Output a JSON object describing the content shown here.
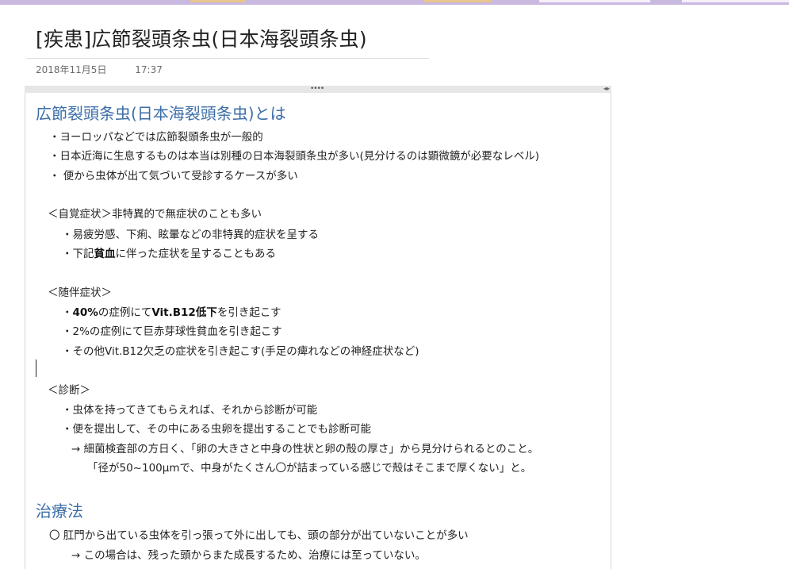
{
  "page": {
    "title": "[疾患]広節裂頭条虫(日本海裂頭条虫)",
    "date": "2018年11月5日",
    "time": "17:37"
  },
  "container": {
    "grip": "••••",
    "resize": "◂▸"
  },
  "note": {
    "heading1": "広節裂頭条虫(日本海裂頭条虫)とは",
    "intro": [
      "・ヨーロッパなどでは広節裂頭条虫が一般的",
      "・日本近海に生息するものは本当は別種の日本海裂頭条虫が多い(見分けるのは顕微鏡が必要なレベル)",
      "・ 便から虫体が出て気づいて受診するケースが多い"
    ],
    "symptoms_header": "＜自覚症状＞非特異的で無症状のことも多い",
    "symptoms": [
      "・易疲労感、下痢、眩暈などの非特異的症状を呈する",
      {
        "pre": "・下記",
        "bold": "貧血",
        "post": "に伴った症状を呈することもある"
      }
    ],
    "accompanying_header": "＜随伴症状＞",
    "accompanying": [
      {
        "pre": "・",
        "bold1": "40%",
        "mid": "の症例にて",
        "bold2": "Vit.B12低下",
        "post": "を引き起こす"
      },
      "・2%の症例にて巨赤芽球性貧血を引き起こす",
      "・その他Vit.B12欠乏の症状を引き起こす(手足の痺れなどの神経症状など)"
    ],
    "diagnosis_header": "＜診断＞",
    "diagnosis": [
      "・虫体を持ってきてもらえれば、それから診断が可能",
      "・便を提出して、その中にある虫卵を提出することでも診断可能",
      "→ 細菌検査部の方日く、「卵の大きさと中身の性状と卵の殻の厚さ」から見分けられるとのこと。",
      "「径が50~100μmで、中身がたくさん〇が詰まっている感じで殻はそこまで厚くない」と。"
    ],
    "heading2": "治療法",
    "treatment": [
      "〇 肛門から出ている虫体を引っ張って外に出しても、頭の部分が出ていないことが多い",
      "→ この場合は、残った頭からまた成長するため、治療には至っていない。"
    ]
  },
  "colors": {
    "heading": "#3b6ea8",
    "topbar": "#c9b8e0"
  }
}
